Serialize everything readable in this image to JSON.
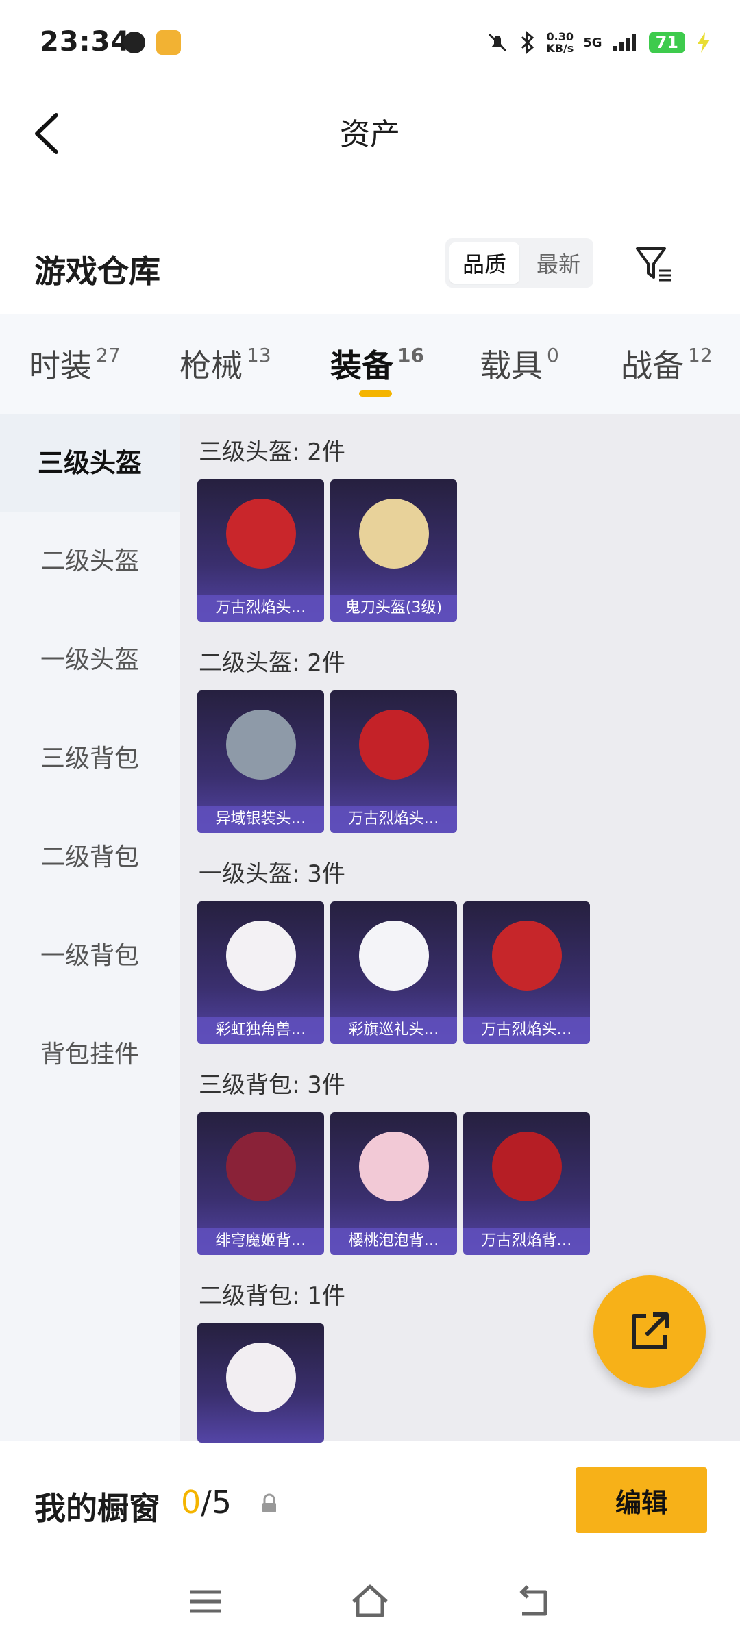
{
  "status_bar": {
    "time": "23:34",
    "net_speed_value": "0.30",
    "net_speed_unit": "KB/s",
    "network": "5G",
    "battery": "71"
  },
  "header": {
    "title": "资产"
  },
  "section": {
    "title": "游戏仓库",
    "sort_options": [
      "品质",
      "最新"
    ],
    "sort_selected": "品质"
  },
  "tabs": [
    {
      "label": "时装",
      "count": "27"
    },
    {
      "label": "枪械",
      "count": "13"
    },
    {
      "label": "装备",
      "count": "16"
    },
    {
      "label": "载具",
      "count": "0"
    },
    {
      "label": "战备",
      "count": "12"
    }
  ],
  "active_tab": "装备",
  "categories": [
    "三级头盔",
    "二级头盔",
    "一级头盔",
    "三级背包",
    "二级背包",
    "一级背包",
    "背包挂件"
  ],
  "active_category": "三级头盔",
  "groups": [
    {
      "title": "三级头盔: 2件",
      "items": [
        {
          "name": "万古烈焰头…",
          "color": "#c9262b"
        },
        {
          "name": "鬼刀头盔(3级)",
          "color": "#e8d29a"
        }
      ]
    },
    {
      "title": "二级头盔: 2件",
      "items": [
        {
          "name": "异域银装头…",
          "color": "#8e9aa8"
        },
        {
          "name": "万古烈焰头…",
          "color": "#c42228"
        }
      ]
    },
    {
      "title": "一级头盔: 3件",
      "items": [
        {
          "name": "彩虹独角兽…",
          "color": "#f3f1f4"
        },
        {
          "name": "彩旗巡礼头…",
          "color": "#f4f4f8"
        },
        {
          "name": "万古烈焰头…",
          "color": "#c6262a"
        }
      ]
    },
    {
      "title": "三级背包: 3件",
      "items": [
        {
          "name": "绯穹魔姬背…",
          "color": "#8a2238"
        },
        {
          "name": "樱桃泡泡背…",
          "color": "#f2c9d6"
        },
        {
          "name": "万古烈焰背…",
          "color": "#b61e25"
        }
      ]
    },
    {
      "title": "二级背包: 1件",
      "items": [
        {
          "name": "",
          "color": "#f2eef2"
        }
      ]
    }
  ],
  "showcase": {
    "label": "我的橱窗",
    "current": "0",
    "total": "/5"
  },
  "edit_label": "编辑",
  "colors": {
    "accent": "#f7b118",
    "card_bg": "#3a2f6e",
    "card_label": "#6050be"
  }
}
